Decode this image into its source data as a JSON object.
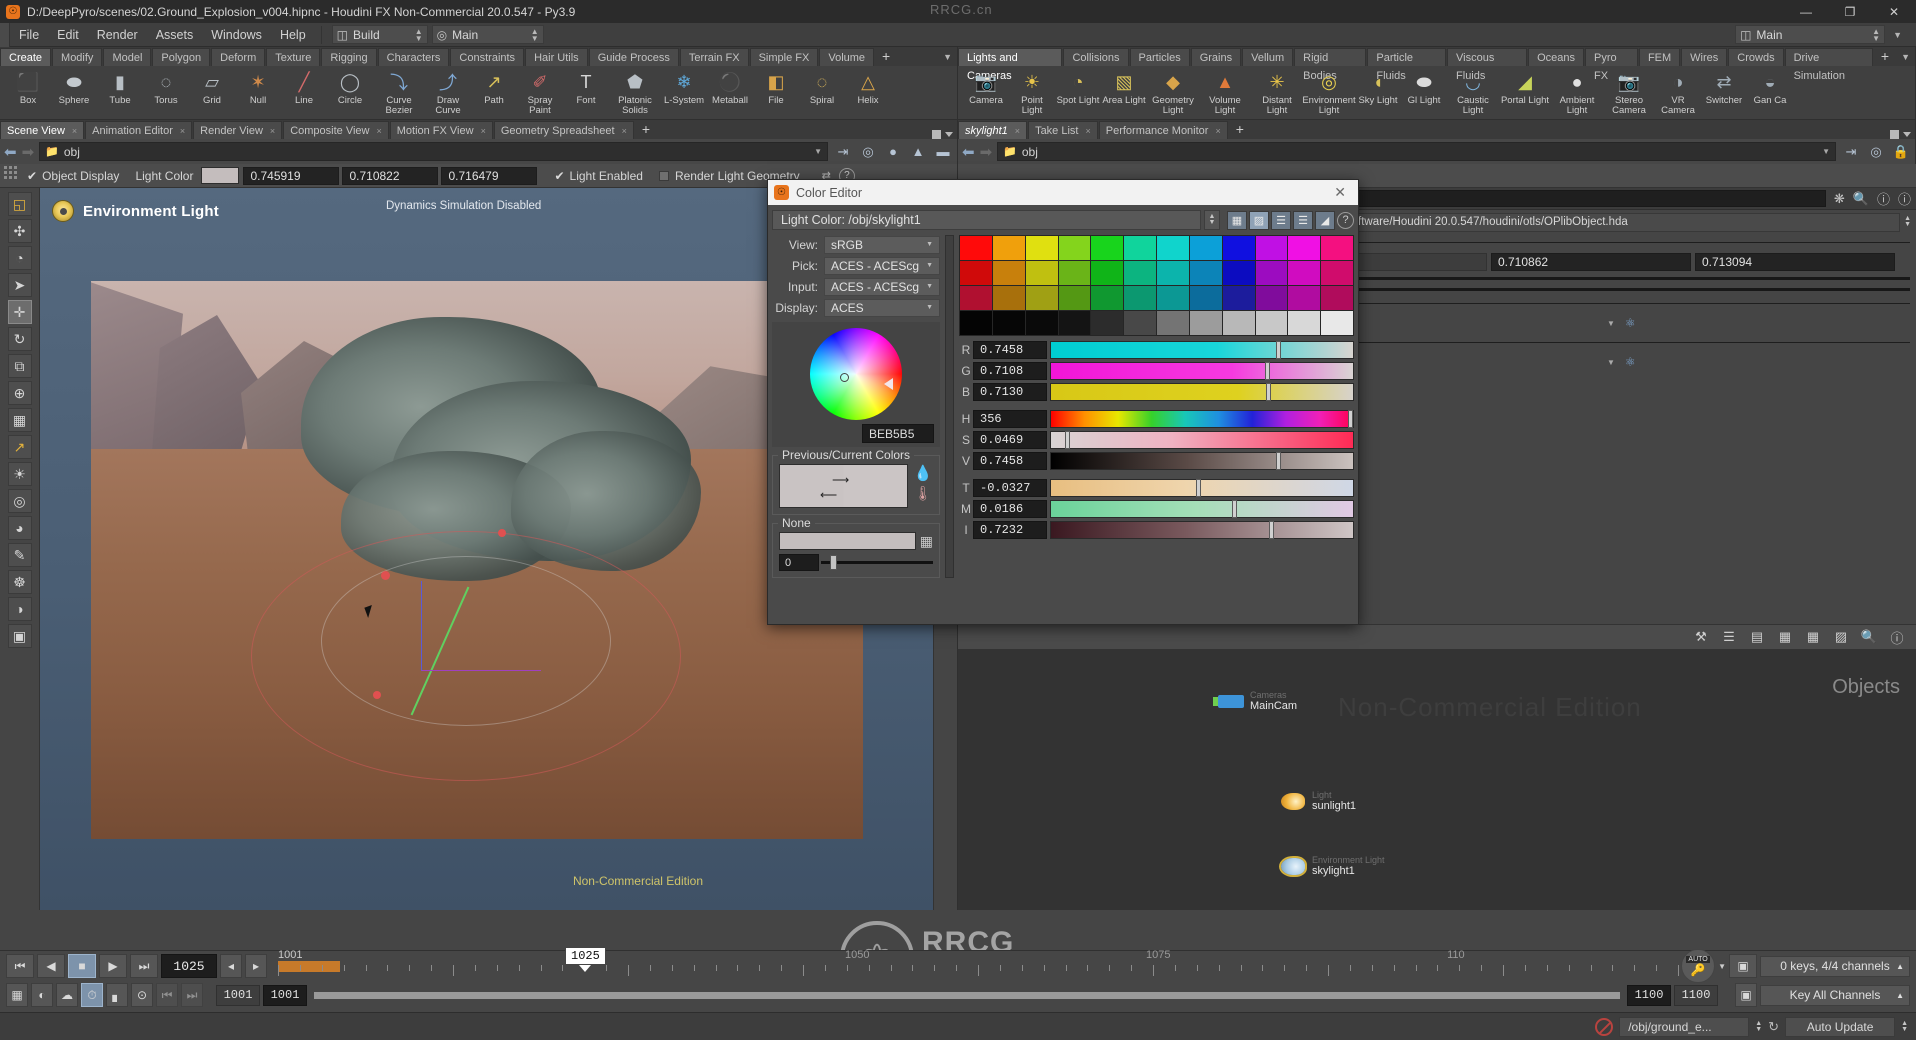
{
  "window": {
    "title": "D:/DeepPyro/scenes/02.Ground_Explosion_v004.hipnc - Houdini FX Non-Commercial 20.0.547 - Py3.9",
    "watermark": "RRCG.cn",
    "minimize": "—",
    "maximize": "❐",
    "close": "✕"
  },
  "menu": {
    "items": [
      "File",
      "Edit",
      "Render",
      "Assets",
      "Windows",
      "Help"
    ],
    "build_label": "Build",
    "desktop_label": "Main",
    "right_desktop_label": "Main"
  },
  "shelf_left": {
    "tabs": [
      "Create",
      "Modify",
      "Model",
      "Polygon",
      "Deform",
      "Texture",
      "Rigging",
      "Characters",
      "Constraints",
      "Hair Utils",
      "Guide Process",
      "Terrain FX",
      "Simple FX",
      "Volume"
    ],
    "active": "Create",
    "add": "+",
    "tools": [
      {
        "label": "Box",
        "icon": "box-icon",
        "glyph": "⬛",
        "color": "#b9c0c6"
      },
      {
        "label": "Sphere",
        "icon": "sphere-icon",
        "glyph": "⬬",
        "color": "#c3c9ce"
      },
      {
        "label": "Tube",
        "icon": "tube-icon",
        "glyph": "▮",
        "color": "#b8bfc5"
      },
      {
        "label": "Torus",
        "icon": "torus-icon",
        "glyph": "◌",
        "color": "#b8bfc5"
      },
      {
        "label": "Grid",
        "icon": "grid-icon",
        "glyph": "▱",
        "color": "#b8bfc5"
      },
      {
        "label": "Null",
        "icon": "null-icon",
        "glyph": "✶",
        "color": "#d08a4a"
      },
      {
        "label": "Line",
        "icon": "line-icon",
        "glyph": "╱",
        "color": "#d36a6a"
      },
      {
        "label": "Circle",
        "icon": "circle-icon",
        "glyph": "◯",
        "color": "#b8bfc5"
      },
      {
        "label": "Curve Bezier",
        "icon": "curve-bezier-icon",
        "glyph": "⤵",
        "color": "#7fa8d4"
      },
      {
        "label": "Draw Curve",
        "icon": "draw-curve-icon",
        "glyph": "⤴",
        "color": "#7fa8d4"
      },
      {
        "label": "Path",
        "icon": "path-icon",
        "glyph": "↗",
        "color": "#d8c05a"
      },
      {
        "label": "Spray Paint",
        "icon": "spray-paint-icon",
        "glyph": "✐",
        "color": "#d26a6a"
      },
      {
        "label": "Font",
        "icon": "font-icon",
        "glyph": "T",
        "color": "#d6d6d6"
      },
      {
        "label": "Platonic Solids",
        "icon": "platonic-solids-icon",
        "glyph": "⬟",
        "color": "#b8bfc5"
      },
      {
        "label": "L-System",
        "icon": "l-system-icon",
        "glyph": "❄",
        "color": "#5fa8d8"
      },
      {
        "label": "Metaball",
        "icon": "metaball-icon",
        "glyph": "⚫",
        "color": "#7fb4dc"
      },
      {
        "label": "File",
        "icon": "file-icon",
        "glyph": "◧",
        "color": "#d8a44a"
      },
      {
        "label": "Spiral",
        "icon": "spiral-icon",
        "glyph": "◌",
        "color": "#d8b45a"
      },
      {
        "label": "Helix",
        "icon": "helix-icon",
        "glyph": "△",
        "color": "#d8a44a"
      }
    ]
  },
  "shelf_right": {
    "tabs": [
      "Lights and Cameras",
      "Collisions",
      "Particles",
      "Grains",
      "Vellum",
      "Rigid Bodies",
      "Particle Fluids",
      "Viscous Fluids",
      "Oceans",
      "Pyro FX",
      "FEM",
      "Wires",
      "Crowds",
      "Drive Simulation"
    ],
    "active": "Lights and Cameras",
    "add": "+",
    "tools": [
      {
        "label": "Camera",
        "icon": "camera-icon",
        "glyph": "📷",
        "color": "#9aa6b0"
      },
      {
        "label": "Point Light",
        "icon": "point-light-icon",
        "glyph": "☀",
        "color": "#e8c44a"
      },
      {
        "label": "Spot Light",
        "icon": "spot-light-icon",
        "glyph": "◔",
        "color": "#dcc25a"
      },
      {
        "label": "Area Light",
        "icon": "area-light-icon",
        "glyph": "▧",
        "color": "#d8c25a"
      },
      {
        "label": "Geometry Light",
        "icon": "geometry-light-icon",
        "glyph": "◆",
        "color": "#d8a44a"
      },
      {
        "label": "Volume Light",
        "icon": "volume-light-icon",
        "glyph": "▲",
        "color": "#e07a3a"
      },
      {
        "label": "Distant Light",
        "icon": "distant-light-icon",
        "glyph": "✳",
        "color": "#e8c44a"
      },
      {
        "label": "Environment Light",
        "icon": "environment-light-icon",
        "glyph": "◎",
        "color": "#e8d050"
      },
      {
        "label": "Sky Light",
        "icon": "sky-light-icon",
        "glyph": "◖",
        "color": "#d8c25a"
      },
      {
        "label": "Gl Light",
        "icon": "gl-light-icon",
        "glyph": "⬬",
        "color": "#dcdcdc"
      },
      {
        "label": "Caustic Light",
        "icon": "caustic-light-icon",
        "glyph": "◡",
        "color": "#7fb4dc"
      },
      {
        "label": "Portal Light",
        "icon": "portal-light-icon",
        "glyph": "◢",
        "color": "#c8d45a"
      },
      {
        "label": "Ambient Light",
        "icon": "ambient-light-icon",
        "glyph": "●",
        "color": "#e0e0e0"
      },
      {
        "label": "Stereo Camera",
        "icon": "stereo-camera-icon",
        "glyph": "📷",
        "color": "#9aa6b0"
      },
      {
        "label": "VR Camera",
        "icon": "vr-camera-icon",
        "glyph": "◑",
        "color": "#a0acb6"
      },
      {
        "label": "Switcher",
        "icon": "switcher-icon",
        "glyph": "⇄",
        "color": "#a0acb6"
      },
      {
        "label": "Gan Ca",
        "icon": "gang-camera-icon",
        "glyph": "◒",
        "color": "#a0acb6"
      }
    ]
  },
  "panes_left": {
    "tabs": [
      "Scene View",
      "Animation Editor",
      "Render View",
      "Composite View",
      "Motion FX View",
      "Geometry Spreadsheet"
    ],
    "active": "Scene View",
    "add": "+",
    "path": "obj"
  },
  "panes_right": {
    "tabs": [
      "skylight1",
      "Take List",
      "Performance Monitor"
    ],
    "active": "skylight1",
    "add": "+",
    "path": "obj"
  },
  "parm_bar": {
    "object_display": "Object Display",
    "light_color_label": "Light Color",
    "r": "0.745919",
    "g": "0.710822",
    "b": "0.716479",
    "light_enabled": "Light Enabled",
    "render_light_geometry": "Render Light Geometry",
    "help": "?"
  },
  "viewport": {
    "title": "Environment Light",
    "status": "Dynamics Simulation Disabled",
    "non_commercial": "Non-Commercial Edition"
  },
  "param_panel": {
    "node_type": "Environment Light",
    "node_name": "skylight1",
    "hda_path": "1/Side Effects Software/Houdini 20.0.547/houdini/otls/OPlibObject.hda",
    "value_g": "0.710862",
    "value_b": "0.713094"
  },
  "network": {
    "watermark": "Non-Commercial Edition",
    "panel_label": "Objects",
    "nodes": [
      {
        "type": "Cameras",
        "name": "MainCam",
        "icon": "camera-node-icon"
      },
      {
        "type": "Light",
        "name": "sunlight1",
        "icon": "light-node-icon"
      },
      {
        "type": "Environment Light",
        "name": "skylight1",
        "icon": "environment-light-node-icon"
      }
    ]
  },
  "color_editor": {
    "title": "Color Editor",
    "close": "✕",
    "path": "Light Color: /obj/skylight1",
    "color_space": [
      {
        "label": "View:",
        "value": "sRGB"
      },
      {
        "label": "Pick:",
        "value": "ACES - ACEScg"
      },
      {
        "label": "Input:",
        "value": "ACES - ACEScg"
      },
      {
        "label": "Display:",
        "value": "ACES"
      }
    ],
    "hex": "BEB5B5",
    "previous_current_label": "Previous/Current Colors",
    "none_label": "None",
    "alpha_value": "0",
    "sliders": [
      {
        "label": "R",
        "value": "0.7458",
        "bar": "linear-gradient(90deg,#00cdd2 0%, #18d6da 55%, #d8d4d0 100%)",
        "knob": 0.745
      },
      {
        "label": "G",
        "value": "0.7108",
        "bar": "linear-gradient(90deg,#f215d8 0%, #f63ae0 60%, #d9d4d3 100%)",
        "knob": 0.71
      },
      {
        "label": "B",
        "value": "0.7130",
        "bar": "linear-gradient(90deg,#d8c816 0%, #ded11f 62%, #d7d2cc 100%)",
        "knob": 0.713
      },
      {
        "label": "H",
        "value": "356",
        "bar": "linear-gradient(90deg,#ff0000,#ff9000,#e8e800,#36d12a,#18c7b8,#1f8fe0,#2222d8,#b020e0,#f020b8,#ff0050)",
        "knob": 0.985
      },
      {
        "label": "S",
        "value": "0.0469",
        "bar": "linear-gradient(90deg,#d8d4d4 0%, #efb2c2 40%, #ff2a55 100%)",
        "knob": 0.047
      },
      {
        "label": "V",
        "value": "0.7458",
        "bar": "linear-gradient(90deg,#000000 0%, #5a4a46 45%, #cbc2bf 100%)",
        "knob": 0.746
      },
      {
        "label": "T",
        "value": "-0.0327",
        "bar": "linear-gradient(90deg,#e8be80 0%, #efd5ad 45%, #cfd7e6 100%)",
        "knob": 0.48
      },
      {
        "label": "M",
        "value": "0.0186",
        "bar": "linear-gradient(90deg,#6ad39a 0%, #a5dfb8 48%, #e1c9e4 100%)",
        "knob": 0.6
      },
      {
        "label": "I",
        "value": "0.7232",
        "bar": "linear-gradient(90deg,#3a1820 0%, #7a5a5e 45%, #cfc6c6 100%)",
        "knob": 0.723
      }
    ],
    "swatch_rows": [
      [
        "#ff0a0a",
        "#f0a00c",
        "#e0e010",
        "#84d41c",
        "#18d41c",
        "#10d49c",
        "#10d4cc",
        "#0ca0d8",
        "#1010e0",
        "#c010e4",
        "#f010e4",
        "#f41080"
      ],
      [
        "#d00a0a",
        "#c8800c",
        "#c0c010",
        "#6ab418",
        "#10b418",
        "#0cb480",
        "#0cb4ac",
        "#0c84b8",
        "#0c0cc0",
        "#9c0cc0",
        "#d00cc0",
        "#d00c6c"
      ],
      [
        "#b01030",
        "#a8700c",
        "#a0a014",
        "#549814",
        "#109830",
        "#0c9870",
        "#0c9894",
        "#0c6c9c",
        "#1c1c9c",
        "#800c9c",
        "#b00ca0",
        "#b00c5c"
      ],
      [
        "#040404",
        "#060606",
        "#0a0a0a",
        "#141414",
        "#2c2c2c",
        "#484848",
        "#747474",
        "#9c9c9c",
        "#b8b8b8",
        "#c8c8c8",
        "#d8d8d8",
        "#e8e8e8"
      ]
    ]
  },
  "playbar": {
    "current_frame": "1025",
    "cursor_frame": "1025",
    "range_start_label": "1001",
    "mid_tick_1": "1050",
    "mid_tick_2": "1075",
    "mid_tick_3": "110",
    "start_field": "1001",
    "start_field2": "1001",
    "end_field": "1100",
    "end_field2": "1100",
    "keys_label": "0 keys, 4/4 channels",
    "key_all_label": "Key All Channels",
    "auto_label": "AUTO"
  },
  "status_bar": {
    "node_path": "/obj/ground_e...",
    "auto_update": "Auto Update"
  }
}
